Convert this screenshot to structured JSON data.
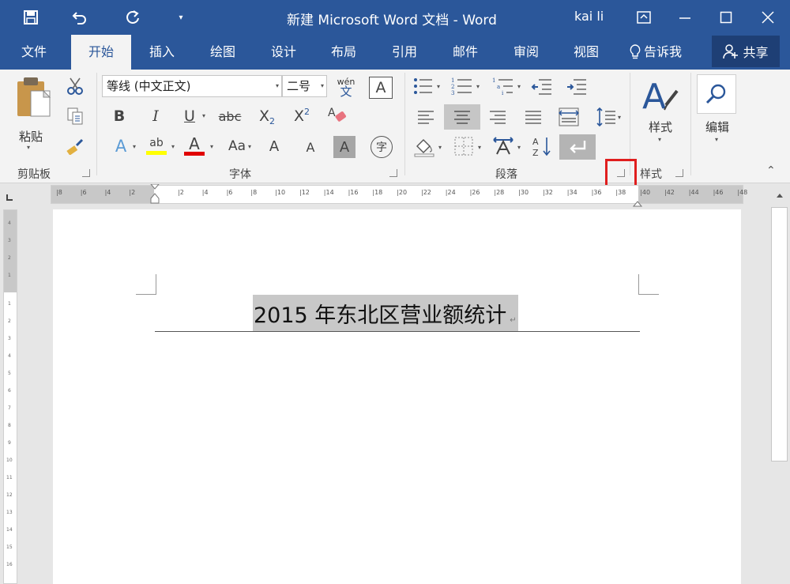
{
  "titlebar": {
    "title": "新建 Microsoft Word 文档  -  Word",
    "user": "kai li",
    "icons": [
      "save-icon",
      "undo-icon",
      "redo-icon",
      "customize-qat-icon",
      "ribbon-display-icon",
      "minimize-icon",
      "maximize-icon",
      "close-icon"
    ]
  },
  "tabs": [
    "文件",
    "开始",
    "插入",
    "绘图",
    "设计",
    "布局",
    "引用",
    "邮件",
    "审阅",
    "视图"
  ],
  "active_tab": "开始",
  "tell_me": "告诉我",
  "share": "共享",
  "clipboard": {
    "paste_label": "粘贴",
    "group": "剪贴板"
  },
  "font": {
    "name": "等线 (中文正文)",
    "size": "二号",
    "group": "字体",
    "wen": "wén",
    "wen_char": "文",
    "bold": "B",
    "italic": "I",
    "underline": "U",
    "strike": "abc",
    "sub": "X",
    "sub_n": "2",
    "sup": "X",
    "sup_n": "2",
    "text_effect": "A",
    "highlight": "ab",
    "font_color": "A",
    "change_case": "Aa",
    "grow": "A",
    "shrink": "A",
    "char_shading": "A",
    "enclose": "字",
    "char_border": "A"
  },
  "paragraph": {
    "group": "段落",
    "sort": "A↓Z"
  },
  "styles": {
    "label": "样式",
    "group": "样式"
  },
  "editing": {
    "label": "编辑"
  },
  "ruler_numbers": [
    "8",
    "6",
    "4",
    "2",
    "",
    "2",
    "4",
    "6",
    "8",
    "10",
    "12",
    "14",
    "16",
    "18",
    "20",
    "22",
    "24",
    "26",
    "28",
    "30",
    "32",
    "34",
    "36",
    "38",
    "40",
    "42",
    "44",
    "46",
    "48"
  ],
  "document": {
    "title_text": "2015 年东北区营业额统计"
  },
  "colors": {
    "accent": "#2b579a",
    "highlight": "#ffff00",
    "font_color": "#e00000",
    "red_box": "#e01e1e"
  }
}
